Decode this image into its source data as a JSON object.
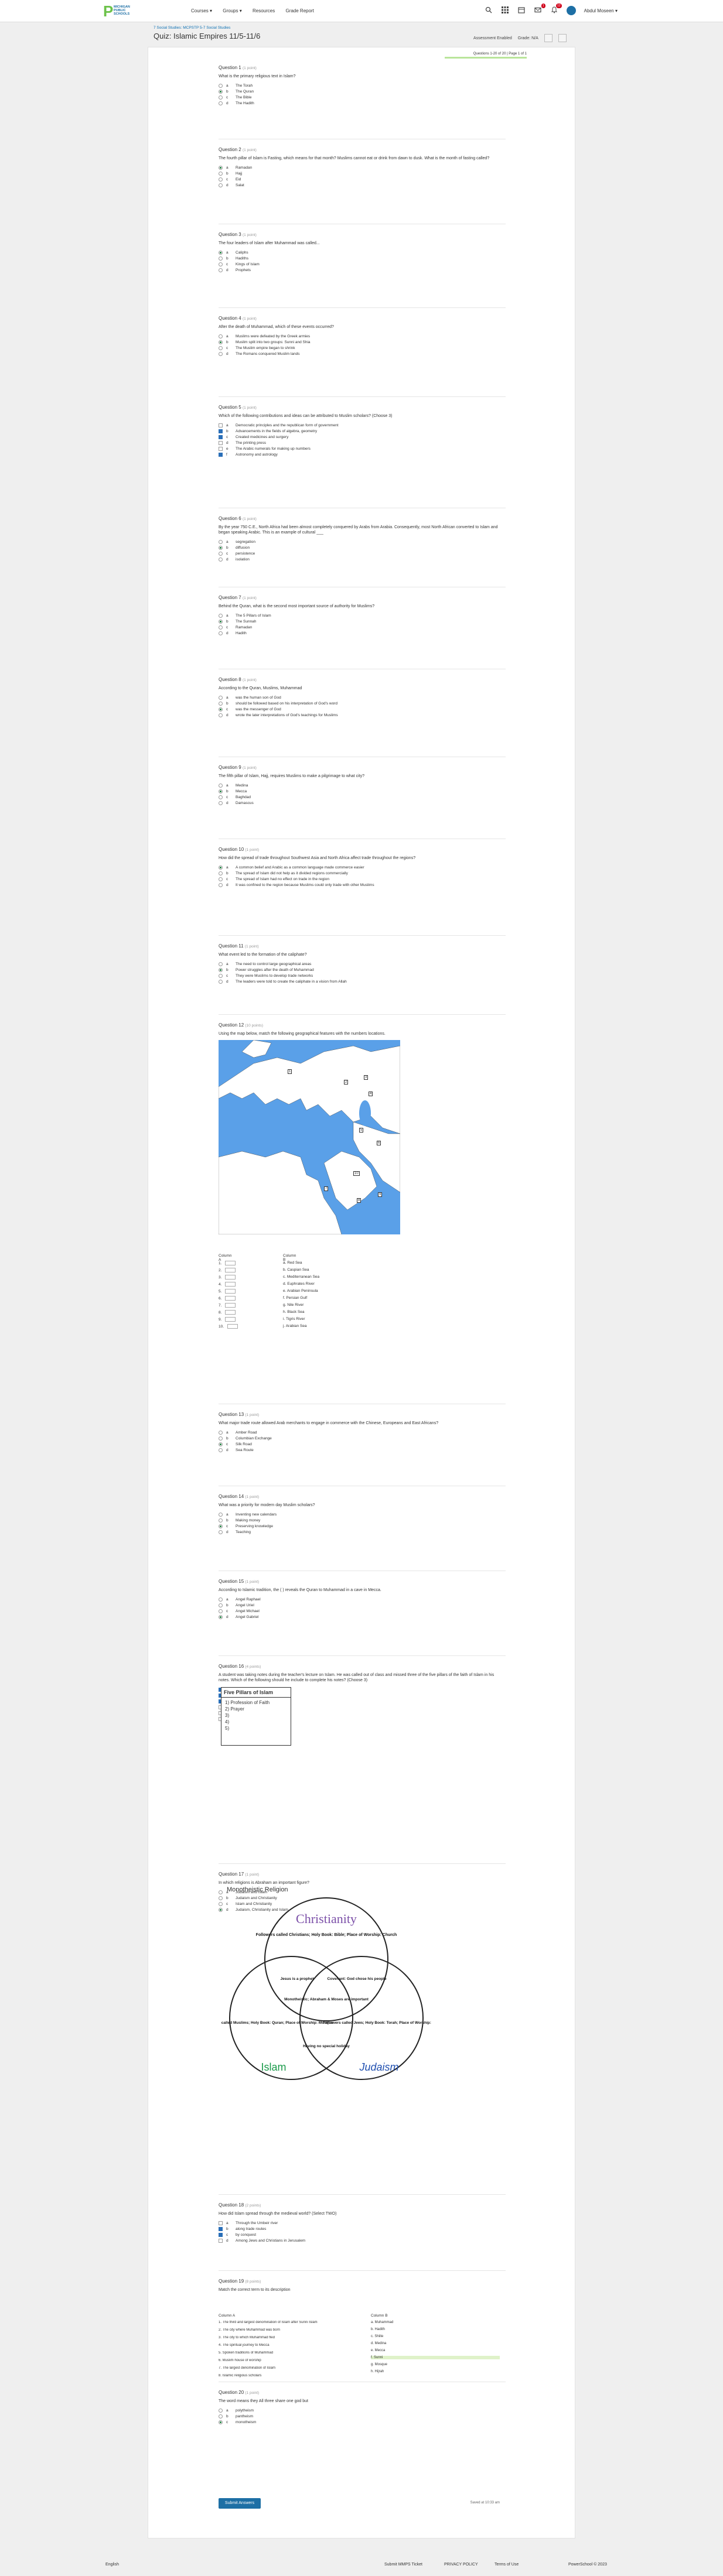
{
  "nav": {
    "logo_letter": "P",
    "logo_text_1": "MICHIGAN",
    "logo_text_2": "PUBLIC",
    "logo_text_3": "SCHOOLS",
    "links": [
      "Courses ▾",
      "Groups ▾",
      "Resources",
      "Grade Report"
    ],
    "user_name": "Abdul Moseen ▾",
    "badge_1": "1",
    "badge_2": "12",
    "icons": [
      "search-icon",
      "apps-grid-icon",
      "calendar-icon",
      "mail-icon",
      "bell-icon"
    ]
  },
  "header": {
    "breadcrumb": "7 Social Studies: MCPSTP 5-7 Social Studies",
    "title": "Quiz: Islamic Empires 11/5-11/6",
    "assessment_label": "Assessment Enabled",
    "grade_label": "Grade:",
    "grade_value": "N/A"
  },
  "progress": {
    "text": "Questions 1-20 of 20 | Page 1 of 1",
    "fraction": 1.0
  },
  "questions": [
    {
      "num": "Question 1",
      "pts": "(1 point)",
      "text": "What is the primary religious text in Islam?",
      "options": [
        [
          "a",
          "The Torah"
        ],
        [
          "b",
          "The Quran"
        ],
        [
          "c",
          "The Bible"
        ],
        [
          "d",
          "The Hadith"
        ]
      ],
      "selected": [
        1
      ],
      "type": "radio"
    },
    {
      "num": "Question 2",
      "pts": "(1 point)",
      "text": "The fourth pillar of Islam is Fasting, which means for that month? Muslims cannot eat or drink from dawn to dusk. What is the month of fasting called?",
      "options": [
        [
          "a",
          "Ramadan"
        ],
        [
          "b",
          "Hajj"
        ],
        [
          "c",
          "Eid"
        ],
        [
          "d",
          "Salat"
        ]
      ],
      "selected": [
        0
      ],
      "type": "radio"
    },
    {
      "num": "Question 3",
      "pts": "(1 point)",
      "text": "The four leaders of Islam after Muhammad was called...",
      "options": [
        [
          "a",
          "Caliphs"
        ],
        [
          "b",
          "Hadiths"
        ],
        [
          "c",
          "Kings of Islam"
        ],
        [
          "d",
          "Prophets"
        ]
      ],
      "selected": [
        0
      ],
      "type": "radio"
    },
    {
      "num": "Question 4",
      "pts": "(1 point)",
      "text": "After the death of Muhammad, which of these events occurred?",
      "options": [
        [
          "a",
          "Muslims were defeated by the Greek armies"
        ],
        [
          "b",
          "Muslim split into two groups: Sunni and Shia"
        ],
        [
          "c",
          "The Muslim empire began to shrink"
        ],
        [
          "d",
          "The Romans conquered Muslim lands"
        ]
      ],
      "selected": [
        1
      ],
      "type": "radio"
    },
    {
      "num": "Question 5",
      "pts": "(1 point)",
      "text": "Which of the following contributions and ideas can be attributed to Muslim scholars? (Choose 3)",
      "options": [
        [
          "a",
          "Democratic principles and the republican form of government"
        ],
        [
          "b",
          "Advancements in the fields of algebra, geometry"
        ],
        [
          "c",
          "Created medicines and surgery"
        ],
        [
          "d",
          "The printing press"
        ],
        [
          "e",
          "The Arabic numerals for making up numbers"
        ],
        [
          "f",
          "Astronomy and astrology"
        ]
      ],
      "selected": [
        1,
        2,
        5
      ],
      "type": "check"
    },
    {
      "num": "Question 6",
      "pts": "(1 point)",
      "text": "By the year 750 C.E., North Africa had been almost completely conquered by Arabs from Arabia. Consequently, most North African converted to Islam and began speaking Arabic. This is an example of cultural ___",
      "options": [
        [
          "a",
          "segregation"
        ],
        [
          "b",
          "diffusion"
        ],
        [
          "c",
          "persistence"
        ],
        [
          "d",
          "isolation"
        ]
      ],
      "selected": [
        1
      ],
      "type": "radio"
    },
    {
      "num": "Question 7",
      "pts": "(1 point)",
      "text": "Behind the Quran, what is the second most important source of authority for Muslims?",
      "options": [
        [
          "a",
          "The 5 Pillars of Islam"
        ],
        [
          "b",
          "The Sunnah"
        ],
        [
          "c",
          "Ramadan"
        ],
        [
          "d",
          "Hadith"
        ]
      ],
      "selected": [
        1
      ],
      "type": "radio"
    },
    {
      "num": "Question 8",
      "pts": "(1 point)",
      "text": "According to the Quran, Muslims, Muhammad",
      "options": [
        [
          "a",
          "was the human son of God"
        ],
        [
          "b",
          "should be followed based on his interpretation of God's word"
        ],
        [
          "c",
          "was the messenger of God"
        ],
        [
          "d",
          "wrote the later interpretations of God's teachings for Muslims"
        ]
      ],
      "selected": [
        2
      ],
      "type": "radio"
    },
    {
      "num": "Question 9",
      "pts": "(1 point)",
      "text": "The fifth pillar of Islam, Hajj, requires Muslims to make a pilgrimage to what city?",
      "options": [
        [
          "a",
          "Medina"
        ],
        [
          "b",
          "Mecca"
        ],
        [
          "c",
          "Baghdad"
        ],
        [
          "d",
          "Damascus"
        ]
      ],
      "selected": [
        1
      ],
      "type": "radio"
    },
    {
      "num": "Question 10",
      "pts": "(1 point)",
      "text": "How did the spread of trade throughout Southwest Asia and North Africa affect trade throughout the regions?",
      "options": [
        [
          "a",
          "A common belief and Arabic as a common language made commerce easier"
        ],
        [
          "b",
          "The spread of Islam did not help as it divided regions commercially"
        ],
        [
          "c",
          "The spread of Islam had no effect on trade in the region"
        ],
        [
          "d",
          "It was confined to the region because Muslims could only trade with other Muslims"
        ]
      ],
      "selected": [
        0
      ],
      "type": "radio"
    },
    {
      "num": "Question 11",
      "pts": "(1 point)",
      "text": "What event led to the formation of the caliphate?",
      "options": [
        [
          "a",
          "The need to control large geographical areas"
        ],
        [
          "b",
          "Power struggles after the death of Muhammad"
        ],
        [
          "c",
          "They were Muslims to develop trade networks"
        ],
        [
          "d",
          "The leaders were told to create the caliphate in a vision from Allah"
        ]
      ],
      "selected": [
        1
      ],
      "type": "radio"
    },
    {
      "num": "Question 12",
      "pts": "(10 points)",
      "text": "Using the map below, match the following geographical features with the numbers locations."
    },
    {
      "num": "Question 13",
      "pts": "(1 point)",
      "text": "What major trade route allowed Arab merchants to engage in commerce with the Chinese, Europeans and East Africans?",
      "options": [
        [
          "a",
          "Amber Road"
        ],
        [
          "b",
          "Columbian Exchange"
        ],
        [
          "c",
          "Silk Road"
        ],
        [
          "d",
          "Sea Route"
        ]
      ],
      "selected": [
        2
      ],
      "type": "radio"
    },
    {
      "num": "Question 14",
      "pts": "(1 point)",
      "text": "What was a priority for modern day Muslim scholars?",
      "options": [
        [
          "a",
          "Inventing new calendars"
        ],
        [
          "b",
          "Making money"
        ],
        [
          "c",
          "Preserving knowledge"
        ],
        [
          "d",
          "Teaching"
        ]
      ],
      "selected": [
        2
      ],
      "type": "radio"
    },
    {
      "num": "Question 15",
      "pts": "(1 point)",
      "text": "According to Islamic tradition, the ( ) reveals the Quran to Muhammad in a cave in Mecca.",
      "options": [
        [
          "a",
          "Angel Raphael"
        ],
        [
          "b",
          "Angel Uriel"
        ],
        [
          "c",
          "Angel Michael"
        ],
        [
          "d",
          "Angel Gabriel"
        ]
      ],
      "selected": [
        3
      ],
      "type": "radio"
    },
    {
      "num": "Question 16",
      "pts": "(4 points)",
      "text": "A student was taking notes during the teacher's lecture on Islam. He was called out of class and missed three of the five pillars of the faith of Islam in his notes. Which of the following should he include to complete his notes? (Choose 3)",
      "options": [
        [
          "a",
          "Pilgrimage"
        ],
        [
          "b",
          "Fasting"
        ],
        [
          "c",
          "Almsgiving"
        ],
        [
          "d",
          "Reincarnation"
        ],
        [
          "e",
          "Baptism"
        ],
        [
          "f",
          "Karma"
        ]
      ],
      "selected": [
        0,
        1,
        2
      ],
      "type": "check"
    },
    {
      "num": "Question 17",
      "pts": "(1 point)",
      "text": "In which religions is Abraham an important figure?",
      "options": [
        [
          "a",
          "Judaism and Islam"
        ],
        [
          "b",
          "Judaism and Christianity"
        ],
        [
          "c",
          "Islam and Christianity"
        ],
        [
          "d",
          "Judaism, Christianity and Islam"
        ]
      ],
      "selected": [
        3
      ],
      "type": "radio"
    },
    {
      "num": "Question 18",
      "pts": "(2 points)",
      "text": "How did Islam spread through the medieval world? (Select TWO)",
      "options": [
        [
          "a",
          "Through the Umbeir river"
        ],
        [
          "b",
          "along trade routes"
        ],
        [
          "c",
          "by conquest"
        ],
        [
          "d",
          "Among Jews and Christians in Jerusalem"
        ]
      ],
      "selected": [
        1,
        2
      ],
      "type": "check"
    },
    {
      "num": "Question 19",
      "pts": "(8 points)",
      "text": "Match the correct term to its description"
    },
    {
      "num": "Question 20",
      "pts": "(1 point)",
      "text": "The word means they All three share one god but",
      "options": [
        [
          "a",
          "polytheism"
        ],
        [
          "b",
          "pantheism"
        ],
        [
          "c",
          "monotheism"
        ]
      ],
      "selected": [
        2
      ],
      "type": "radio"
    }
  ],
  "q12": {
    "col_a": "Column A",
    "col_b": "Column B",
    "a_items": [
      "1.",
      "2.",
      "3.",
      "4.",
      "5.",
      "6.",
      "7.",
      "8.",
      "9.",
      "10."
    ],
    "b_items": [
      "a. Red Sea",
      "b. Caspian Sea",
      "c. Mediterranean Sea",
      "d. Euphrates River",
      "e. Arabian Peninsula",
      "f. Persian Gulf",
      "g. Nile River",
      "h. Black Sea",
      "i. Tigris River",
      "j. Arabian Sea"
    ],
    "map_labels": [
      "1",
      "2",
      "3",
      "4",
      "5",
      "6",
      "7",
      "8",
      "9",
      "10"
    ]
  },
  "q16_box": {
    "title": "Five Pillars of Islam",
    "items": [
      "1) Profession of Faith",
      "2) Prayer",
      "3)",
      "4)",
      "5)"
    ]
  },
  "venn": {
    "title": "Monotheistic Religion",
    "christianity": "Christianity",
    "islam": "Islam",
    "judaism": "Judaism",
    "christ_text": "Followers called Christians; Holy Book: Bible; Place of Worship: Church",
    "islam_text": "Followers called Muslims; Holy Book: Quran; Place of Worship: Mosque",
    "judaism_text": "Followers called Jews; Holy Book: Torah; Place of Worship: Synagogue",
    "center_text": "Monotheistic; Abraham & Moses are important",
    "ci_text": "Jesus is a prophet",
    "cj_text": "Covenant: God chose his people",
    "ij_text": "Having no special holiday"
  },
  "q19": {
    "col_a": "Column A",
    "col_b": "Column B",
    "a_items": [
      "1. The third and largest denomination of Islam after Sunni Islam",
      "2. The city where Muhammad was born",
      "3. The city to which Muhammad fled",
      "4. The spiritual journey to Mecca",
      "5. Spoken traditions of Muhammad",
      "6. Muslim house of worship",
      "7. The largest denomination of Islam",
      "8. Islamic religious scholars"
    ],
    "b_items": [
      "a. Muhammad",
      "b. Hadith",
      "c. Shiite",
      "d. Medina",
      "e. Mecca",
      "f. Sunni",
      "g. Mosque",
      "h. Hijrah"
    ]
  },
  "submit_label": "Submit Answers",
  "saved_text": "Saved at 10:33 am",
  "footer": {
    "lang": "English",
    "links": [
      "Submit MMPS Ticket",
      "PRIVACY POLICY",
      "Terms of Use"
    ],
    "copyright": "PowerSchool © 2023"
  }
}
